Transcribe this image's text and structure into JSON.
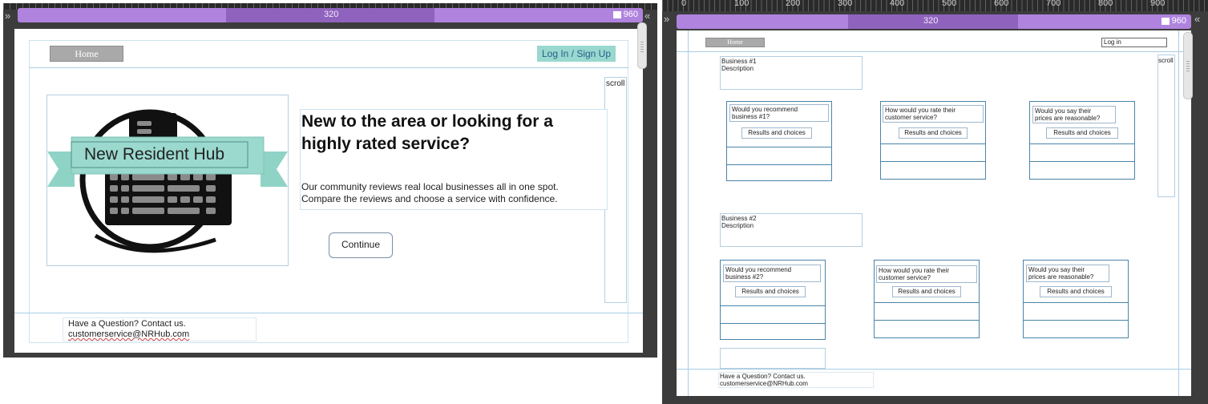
{
  "left": {
    "breakpoint_label": "320",
    "breakpoint_right": "960",
    "nav": {
      "home": "Home",
      "login": "Log In / Sign Up"
    },
    "scroll_label": "scroll",
    "logo_text": "New Resident Hub",
    "headline": "New to the area or looking for a highly rated service?",
    "description_line1": "Our community reviews real local businesses all in one spot.",
    "description_line2": "Compare the reviews and choose a service with confidence.",
    "continue": "Continue",
    "footer": {
      "question": "Have a Question? Contact us.",
      "email": "customerservice@NRHub.com"
    }
  },
  "right": {
    "ruler_labels": [
      "0",
      "100",
      "200",
      "300",
      "400",
      "500",
      "600",
      "700",
      "800",
      "900"
    ],
    "breakpoint_label": "320",
    "breakpoint_right": "960",
    "nav": {
      "home": "Home",
      "login": "Log in"
    },
    "scroll_label": "scroll",
    "business1": {
      "title": "Business #1",
      "desc": "Description",
      "questions": [
        {
          "line1": "Would you recommend",
          "line2": "business #1?",
          "result": "Results and choices"
        },
        {
          "line1": "How would you rate their",
          "line2": "customer service?",
          "result": "Results and choices"
        },
        {
          "line1": "Would you say their",
          "line2": "prices are reasonable?",
          "result": "Results and choices"
        }
      ]
    },
    "business2": {
      "title": "Business #2",
      "desc": "Description",
      "questions": [
        {
          "line1": "Would you recommend",
          "line2": "business #2?",
          "result": "Results and choices"
        },
        {
          "line1": "How would you rate their",
          "line2": "customer service?",
          "result": "Results and choices"
        },
        {
          "line1": "Would you say their",
          "line2": "prices are reasonable?",
          "result": "Results and choices"
        }
      ]
    },
    "footer": {
      "question": "Have a Question? Contact us.",
      "email": "customerservice@NRHub.com"
    }
  },
  "colors": {
    "breakpoint_bar": "#b083de",
    "login_button": "#98d8cf",
    "home_button": "#a9a9a9",
    "logo_banner": "#8fd3c7"
  }
}
